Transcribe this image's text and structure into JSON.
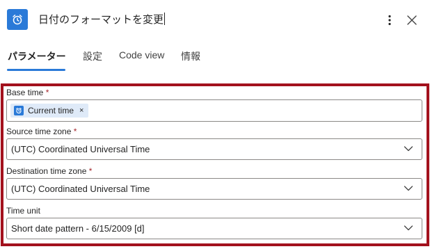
{
  "header": {
    "title": "日付のフォーマットを変更",
    "app_icon": "alarm-clock-icon",
    "more_icon": "more-vertical-icon",
    "close_icon": "close-icon",
    "accent_color": "#2a7ad8"
  },
  "tabs": [
    {
      "label": "パラメーター",
      "active": true
    },
    {
      "label": "設定",
      "active": false
    },
    {
      "label": "Code view",
      "active": false
    },
    {
      "label": "情報",
      "active": false
    }
  ],
  "fields": {
    "base_time": {
      "label": "Base time",
      "required_mark": "*",
      "token_label": "Current time",
      "token_remove": "×",
      "token_icon": "alarm-clock-icon"
    },
    "source_time_zone": {
      "label": "Source time zone",
      "required_mark": "*",
      "value": "(UTC) Coordinated Universal Time"
    },
    "destination_time_zone": {
      "label": "Destination time zone",
      "required_mark": "*",
      "value": "(UTC) Coordinated Universal Time"
    },
    "time_unit": {
      "label": "Time unit",
      "value": "Short date pattern - 6/15/2009 [d]"
    }
  },
  "highlight_color": "#a3111d"
}
